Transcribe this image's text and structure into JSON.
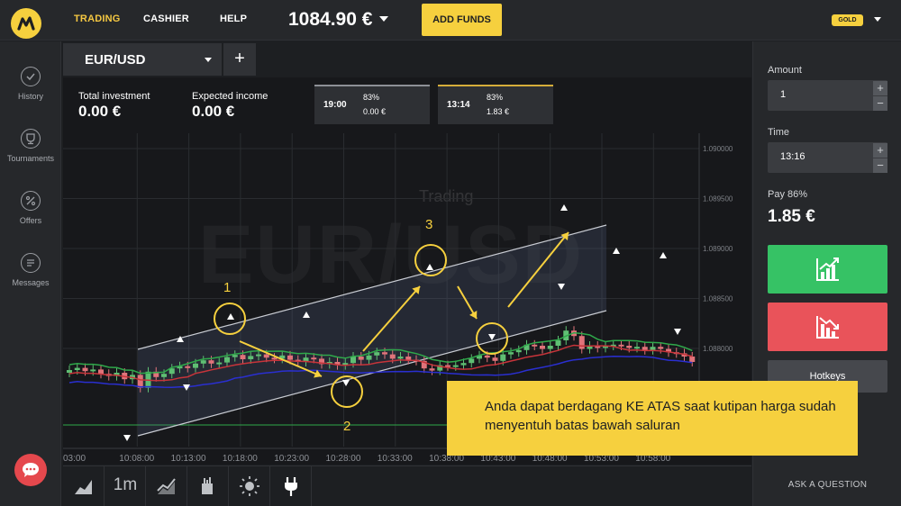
{
  "nav": {
    "items": [
      {
        "label": "TRADING",
        "active": true
      },
      {
        "label": "CASHIER",
        "active": false
      },
      {
        "label": "HELP",
        "active": false
      }
    ],
    "balance": "1084.90 €",
    "add_funds_label": "ADD FUNDS",
    "account_badge": "GOLD"
  },
  "sidebar": {
    "items": [
      {
        "label": "History",
        "icon": "clock-check-icon"
      },
      {
        "label": "Tournaments",
        "icon": "trophy-icon"
      },
      {
        "label": "Offers",
        "icon": "percent-icon"
      },
      {
        "label": "Messages",
        "icon": "messages-icon"
      }
    ]
  },
  "asset": {
    "name": "EUR/USD",
    "add_tab_label": "+",
    "watermark": "EUR/USD",
    "watermark_mode": "Trading"
  },
  "stats": {
    "total_investment_label": "Total investment",
    "total_investment_value": "0.00 €",
    "expected_income_label": "Expected income",
    "expected_income_value": "0.00 €"
  },
  "trade_cards": [
    {
      "time": "19:00",
      "percent": "83%",
      "amount": "0.00 €"
    },
    {
      "time": "13:14",
      "percent": "83%",
      "amount": "1.83 €"
    }
  ],
  "chart_data": {
    "type": "candlestick",
    "instrument": "EUR/USD",
    "y_ticks": [
      "1.090000",
      "1.089500",
      "1.089000",
      "1.088500",
      "1.088000"
    ],
    "ylim": [
      1.08755,
      1.09005
    ],
    "x_ticks": [
      "03:00",
      "10:08:00",
      "10:13:00",
      "10:18:00",
      "10:23:00",
      "10:28:00",
      "10:33:00",
      "10:38:00",
      "10:43:00",
      "10:48:00",
      "10:53:00",
      "10:58:00"
    ],
    "grid": true,
    "annotations": [
      "1",
      "2",
      "3"
    ],
    "colors": {
      "up": "#5fbf73",
      "down": "#e0737a",
      "ma_red": "#c7343a",
      "ma_green": "#2fa84a",
      "ma_blue": "#2a2fd0",
      "annotation": "#f6d03e"
    }
  },
  "toolbar": {
    "timeframe_label": "1m",
    "tools": [
      "area-chart-icon",
      "timeframe",
      "indicator-icon",
      "drawing-tools-icon",
      "theme-sun-icon",
      "plug-icon"
    ]
  },
  "right_panel": {
    "amount_label": "Amount",
    "amount_value": "1",
    "time_label": "Time",
    "time_value": "13:16",
    "payout_label": "Pay 86%",
    "payout_value": "1.85 €",
    "up_icon": "chart-up-icon",
    "down_icon": "chart-down-icon",
    "hotkeys_label": "Hotkeys",
    "ask_question_label": "ASK A QUESTION"
  },
  "tooltip": {
    "text": "Anda dapat berdagang KE ATAS saat kutipan harga sudah menyentuh batas bawah saluran"
  }
}
